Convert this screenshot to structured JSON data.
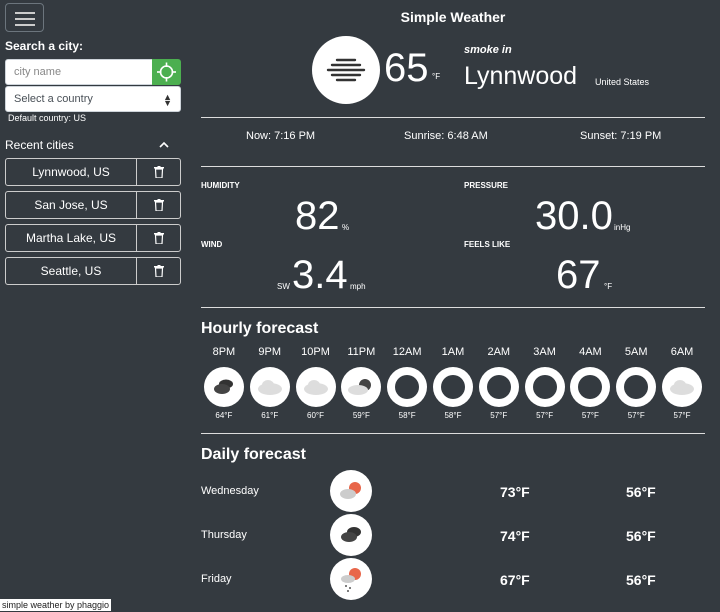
{
  "app": {
    "title": "Simple Weather",
    "footer": "simple weather by phaggio"
  },
  "search": {
    "label": "Search a city:",
    "city_placeholder": "city name",
    "country_select": "Select a country",
    "default_country": "Default country: US"
  },
  "recent": {
    "title": "Recent cities",
    "items": [
      {
        "label": "Lynnwood, US"
      },
      {
        "label": "San Jose, US"
      },
      {
        "label": "Martha Lake, US"
      },
      {
        "label": "Seattle, US"
      }
    ]
  },
  "current": {
    "temp": "65",
    "temp_unit": "°F",
    "condition": "smoke in",
    "city": "Lynnwood",
    "country": "United States",
    "icon": "smoke-icon",
    "now": "Now: 7:16 PM",
    "sunrise": "Sunrise: 6:48 AM",
    "sunset": "Sunset: 7:19 PM"
  },
  "stats": {
    "humidity": {
      "label": "HUMIDITY",
      "value": "82",
      "unit": "%"
    },
    "pressure": {
      "label": "PRESSURE",
      "value": "30.0",
      "unit": "inHg"
    },
    "wind": {
      "label": "WIND",
      "dir": "SW",
      "value": "3.4",
      "unit": "mph"
    },
    "feels_like": {
      "label": "FEELS LIKE",
      "value": "67",
      "unit": "°F"
    }
  },
  "hourly": {
    "title": "Hourly forecast",
    "items": [
      {
        "time": "8PM",
        "temp": "64°F",
        "icon": "broken-clouds-icon"
      },
      {
        "time": "9PM",
        "temp": "61°F",
        "icon": "cloud-icon"
      },
      {
        "time": "10PM",
        "temp": "60°F",
        "icon": "cloud-icon"
      },
      {
        "time": "11PM",
        "temp": "59°F",
        "icon": "partly-cloudy-night-icon"
      },
      {
        "time": "12AM",
        "temp": "58°F",
        "icon": "clear-night-icon"
      },
      {
        "time": "1AM",
        "temp": "58°F",
        "icon": "clear-night-icon"
      },
      {
        "time": "2AM",
        "temp": "57°F",
        "icon": "clear-night-icon"
      },
      {
        "time": "3AM",
        "temp": "57°F",
        "icon": "clear-night-icon"
      },
      {
        "time": "4AM",
        "temp": "57°F",
        "icon": "clear-night-icon"
      },
      {
        "time": "5AM",
        "temp": "57°F",
        "icon": "clear-night-icon"
      },
      {
        "time": "6AM",
        "temp": "57°F",
        "icon": "cloud-icon"
      }
    ]
  },
  "daily": {
    "title": "Daily forecast",
    "items": [
      {
        "day": "Wednesday",
        "high": "73°F",
        "low": "56°F",
        "icon": "partly-cloudy-icon"
      },
      {
        "day": "Thursday",
        "high": "74°F",
        "low": "56°F",
        "icon": "broken-clouds-icon"
      },
      {
        "day": "Friday",
        "high": "67°F",
        "low": "56°F",
        "icon": "rain-sun-icon"
      }
    ]
  },
  "colors": {
    "background": "#343a40",
    "locate_button": "#4caf50",
    "sun_accent": "#e8664a"
  }
}
